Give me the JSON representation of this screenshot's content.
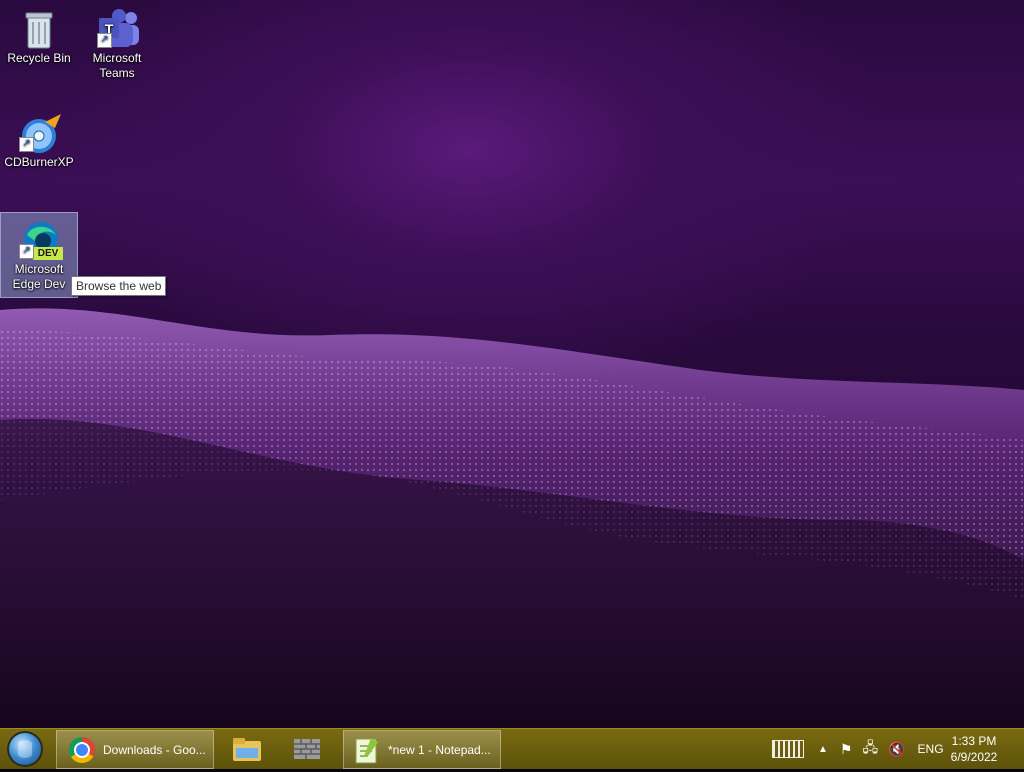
{
  "desktop": {
    "icons": [
      {
        "label": "Recycle Bin"
      },
      {
        "label": "Microsoft\nTeams"
      },
      {
        "label": "CDBurnerXP"
      },
      {
        "label": "Microsoft\nEdge Dev",
        "badge": "DEV"
      }
    ],
    "tooltip": "Browse the web"
  },
  "taskbar": {
    "buttons": [
      {
        "label": "Downloads - Goo...",
        "icon": "chrome-icon"
      },
      {
        "label": "",
        "icon": "file-explorer-icon"
      },
      {
        "label": "",
        "icon": "firewall-icon"
      },
      {
        "label": "*new 1 - Notepad...",
        "icon": "notepad-plus-plus-icon"
      }
    ],
    "tray": {
      "language": "ENG",
      "time": "1:33 PM",
      "date": "6/9/2022"
    }
  },
  "colors": {
    "taskbar": "#6a5d0d",
    "accent": "#3c0f57"
  }
}
